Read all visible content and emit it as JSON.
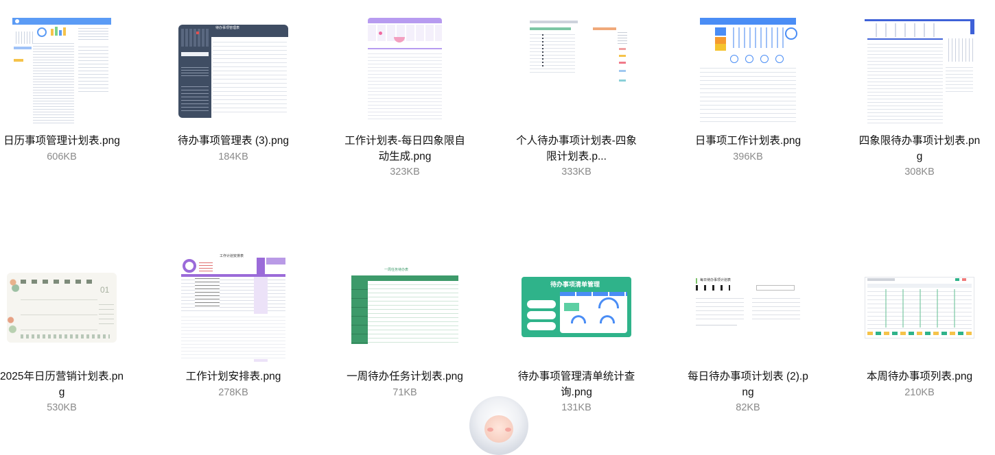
{
  "files": [
    {
      "name_lines": [
        "日历事项管理计划表.png"
      ],
      "size": "606KB"
    },
    {
      "name_lines": [
        "待办事项管理表 (3).png"
      ],
      "size": "184KB"
    },
    {
      "name_lines": [
        "工作计划表-每日四象限自",
        "动生成.png"
      ],
      "size": "323KB"
    },
    {
      "name_lines": [
        "个人待办事项计划表-四象",
        "限计划表.p..."
      ],
      "size": "333KB"
    },
    {
      "name_lines": [
        "日事项工作计划表.png"
      ],
      "size": "396KB"
    },
    {
      "name_lines": [
        "四象限待办事项计划表.pn",
        "g"
      ],
      "size": "308KB"
    },
    {
      "name_lines": [
        "2025年日历营销计划表.pn",
        "g"
      ],
      "size": "530KB"
    },
    {
      "name_lines": [
        "工作计划安排表.png"
      ],
      "size": "278KB"
    },
    {
      "name_lines": [
        "一周待办任务计划表.png"
      ],
      "size": "71KB"
    },
    {
      "name_lines": [
        "待办事项管理清单统计查",
        "询.png"
      ],
      "size": "131KB"
    },
    {
      "name_lines": [
        "每日待办事项计划表 (2).p",
        "ng"
      ],
      "size": "82KB"
    },
    {
      "name_lines": [
        "本周待办事项列表.png"
      ],
      "size": "210KB"
    }
  ],
  "thumb_text": {
    "t2_title": "待办事项管理表",
    "t8_title": "工作计划安排表",
    "t9_title": "一周任务待办表",
    "t10_title": "待办事项清单管理",
    "t11_title": "每日待办事项计划表"
  },
  "colors": {
    "accent_blue": "#4a8df5",
    "dark_slate": "#3f4d63",
    "purple": "#9b6bd9",
    "teal": "#2fb38a",
    "green_table": "#3d9a6a"
  }
}
